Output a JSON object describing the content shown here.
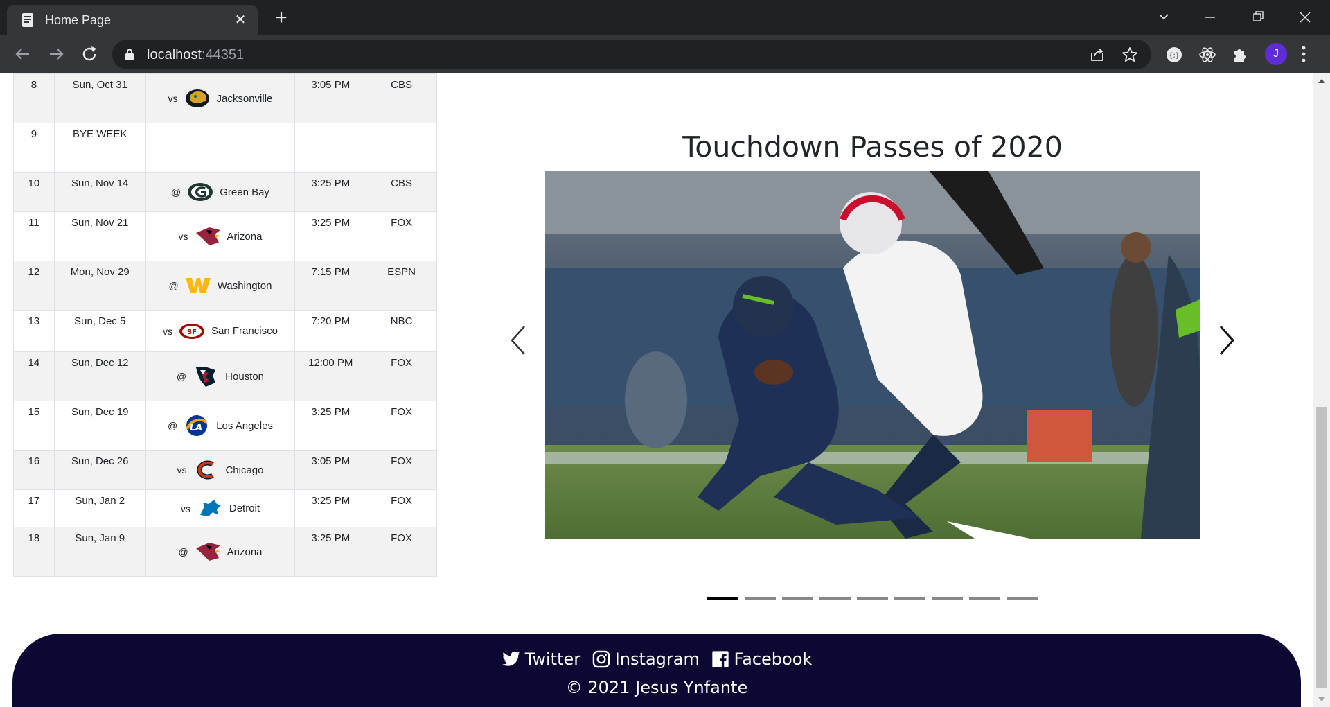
{
  "browser": {
    "tab_title": "Home Page",
    "url_host": "localhost",
    "url_port": ":44351",
    "avatar_letter": "J"
  },
  "schedule": [
    {
      "week": "8",
      "date": "Sun, Oct 31",
      "prefix": "vs",
      "opponent": "Jacksonville",
      "logo": "jaguars-logo",
      "time": "3:05 PM",
      "network": "CBS"
    },
    {
      "week": "9",
      "date": "BYE WEEK",
      "prefix": "",
      "opponent": "",
      "logo": "",
      "time": "",
      "network": ""
    },
    {
      "week": "10",
      "date": "Sun, Nov 14",
      "prefix": "@",
      "opponent": "Green Bay",
      "logo": "packers-logo",
      "time": "3:25 PM",
      "network": "CBS"
    },
    {
      "week": "11",
      "date": "Sun, Nov 21",
      "prefix": "vs",
      "opponent": "Arizona",
      "logo": "cardinals-logo",
      "time": "3:25 PM",
      "network": "FOX"
    },
    {
      "week": "12",
      "date": "Mon, Nov 29",
      "prefix": "@",
      "opponent": "Washington",
      "logo": "washington-logo",
      "time": "7:15 PM",
      "network": "ESPN"
    },
    {
      "week": "13",
      "date": "Sun, Dec 5",
      "prefix": "vs",
      "opponent": "San Francisco",
      "logo": "49ers-logo",
      "time": "7:20 PM",
      "network": "NBC"
    },
    {
      "week": "14",
      "date": "Sun, Dec 12",
      "prefix": "@",
      "opponent": "Houston",
      "logo": "texans-logo",
      "time": "12:00 PM",
      "network": "FOX"
    },
    {
      "week": "15",
      "date": "Sun, Dec 19",
      "prefix": "@",
      "opponent": "Los Angeles",
      "logo": "rams-logo",
      "time": "3:25 PM",
      "network": "FOX"
    },
    {
      "week": "16",
      "date": "Sun, Dec 26",
      "prefix": "vs",
      "opponent": "Chicago",
      "logo": "bears-logo",
      "time": "3:05 PM",
      "network": "FOX"
    },
    {
      "week": "17",
      "date": "Sun, Jan 2",
      "prefix": "vs",
      "opponent": "Detroit",
      "logo": "lions-logo",
      "time": "3:25 PM",
      "network": "FOX"
    },
    {
      "week": "18",
      "date": "Sun, Jan 9",
      "prefix": "@",
      "opponent": "Arizona",
      "logo": "cardinals-logo",
      "time": "3:25 PM",
      "network": "FOX"
    }
  ],
  "carousel": {
    "title": "Touchdown Passes of 2020",
    "slide_count": 9,
    "active_index": 0
  },
  "footer": {
    "twitter": "Twitter",
    "instagram": "Instagram",
    "facebook": "Facebook",
    "copyright": "© 2021 Jesus Ynfante"
  }
}
